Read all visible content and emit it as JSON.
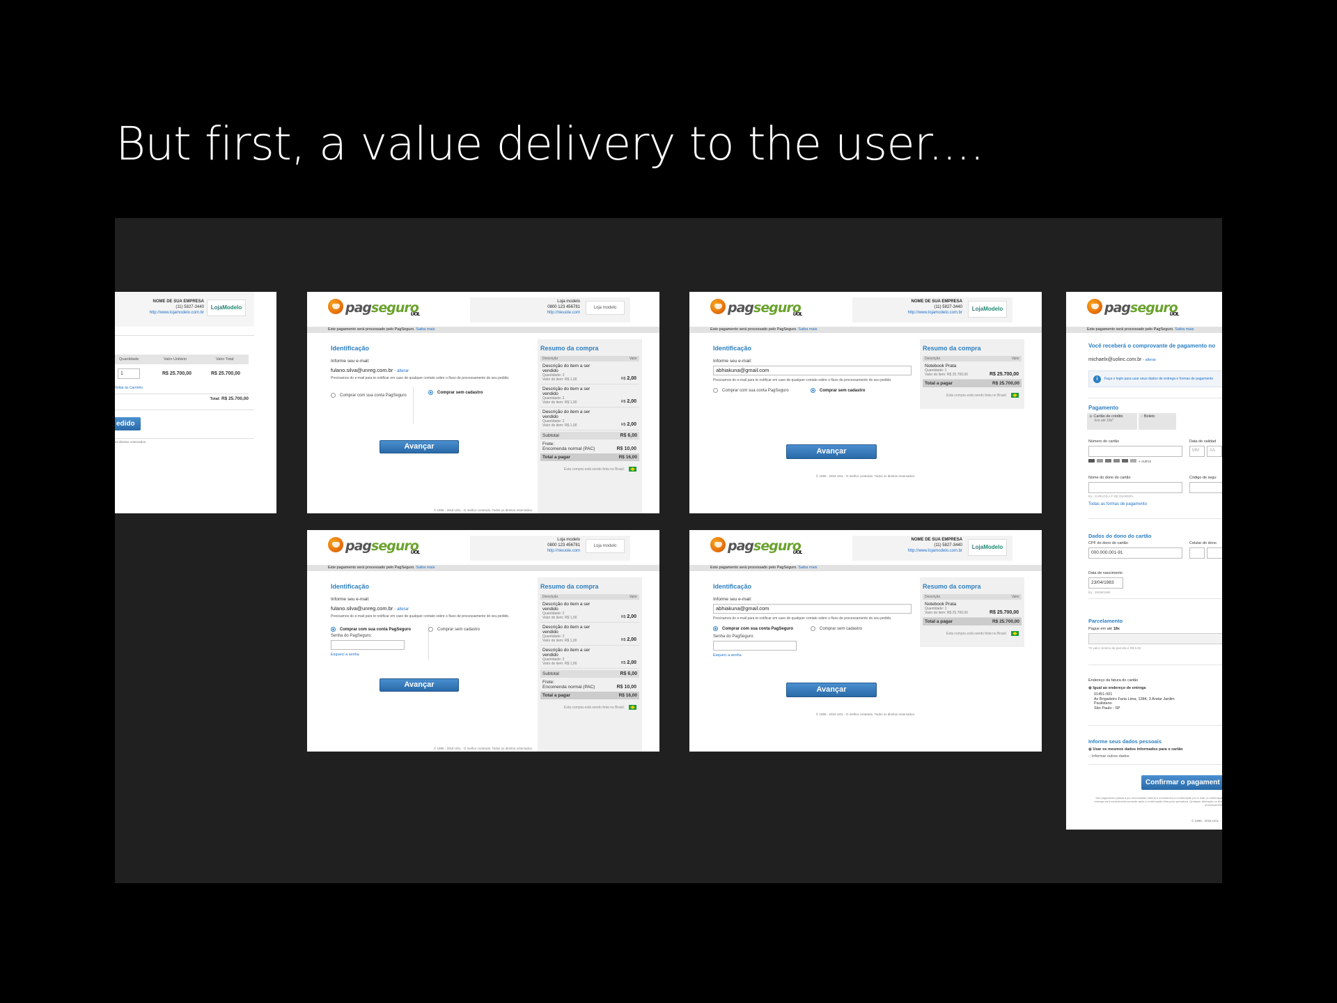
{
  "slide": {
    "title": "But first, a value delivery to the user...."
  },
  "common": {
    "logo_text_a": "pag",
    "logo_text_b": "seguro",
    "logo_uol": "UOL",
    "bar_text": "Este pagamento será processado pelo PagSeguro.",
    "bar_link": "Saiba mais",
    "ident_title": "Identificação",
    "email_label": "Informe seu e-mail:",
    "alterar": "- alterar",
    "note": "Precisamos do e-mail para te notificar em caso de qualquer contato sobre o fluxo de processamento do seu pedido.",
    "radio_account": "Comprar com sua conta PagSeguro",
    "radio_guest": "Comprar sem cadastro",
    "pwd_label": "Senha do PagSeguro:",
    "forgot": "Esqueci a senha",
    "button": "Avançar",
    "summary_title": "Resumo da compra",
    "col_desc": "Descrição",
    "col_val": "Valor",
    "subtotal_label": "Subtotal",
    "total_label": "Total a pagar",
    "brazil_note": "Esta compra está sendo feita no",
    "brazil_word": "Brasil.",
    "footer_a": "© 1996 - 2018 UOL - O melhor conteúdo. Todos os direitos reservados.",
    "footer_b": "© 1996 - 2018 UOL - O melhor conteúdo. Todos os direitos reservados."
  },
  "store_a": {
    "line1": "Loja modelo",
    "line2": "0800 123 456781",
    "link": "http://nieuole.com",
    "img_alt": "Loja modelo"
  },
  "store_b": {
    "line1": "NOME DE SUA EMPRESA",
    "line2": "(11) 5827-3440",
    "link": "http://www.lojamodelo.com.br",
    "brand_a": "Loja",
    "brand_b": "Modelo"
  },
  "emails": {
    "a": "fulano.silva@unreg.com.br",
    "b": "abhiakuna@gmail.com",
    "c": "michaelx@uolinc.com.br"
  },
  "items": [
    {
      "desc": "Descrição do item a ser vendido",
      "qty": "Quantidade: 2",
      "unit": "Valor do item: R$ 1,00",
      "rs": "R$",
      "val": "2,00"
    },
    {
      "desc": "Descrição do item a ser vendido",
      "qty": "Quantidade: 2",
      "unit": "Valor do item: R$ 1,00",
      "rs": "R$",
      "val": "2,00"
    },
    {
      "desc": "Descrição do item a ser vendido",
      "qty": "Quantidade: 2",
      "unit": "Valor do item: R$ 1,00",
      "rs": "R$",
      "val": "2,00"
    }
  ],
  "subtotal": "R$ 6,00",
  "frete": {
    "label": "Frete:",
    "desc": "Encomenda normal (PAC)",
    "val": "R$ 10,00"
  },
  "total_a": "R$ 16,00",
  "notebook": {
    "desc": "Notebook Prata",
    "qty": "Quantidade: 1",
    "unit": "Valor do item: R$ 25.700,00",
    "val": "R$ 25.700,00"
  },
  "total_b": "R$ 25.700,00",
  "cart": {
    "col_qty": "Quantidade",
    "col_unit": "Valor Unitário",
    "col_total": "Valor Total",
    "qty": "1",
    "unit": "R$ 25.700,00",
    "total": "R$ 25.700,00",
    "back": "Voltar às Carrinho",
    "total_label": "Total:",
    "total_val": "R$ 25.700,00",
    "btn": "edido",
    "footer": "os direitos reservados."
  },
  "partial": {
    "receipt": "Você receberá o comprovante de pagamento no",
    "login_note": "Faça o login para usar seus dados de entrega e formas de pagamento",
    "pay_title": "Pagamento",
    "card": "Cartão de crédito",
    "card_sub": "Em até 18x*",
    "boleto": "Boleto",
    "card_num": "Número do cartão",
    "validity": "Data de validad",
    "mm": "MM",
    "aa": "AA",
    "more": "+ outros",
    "owner_name": "Nome do dono do cartão",
    "cvv": "Código de segu",
    "owner_hint": "Ex.: CARLOS A F DE OLIVEIRA",
    "all_methods": "Todas as formas de pagamento",
    "owner_title": "Dados do dono do cartão",
    "cpf_label": "CPF do dono do cartão",
    "cpf": "000.000.001-91",
    "cel": "Celular do dono",
    "birth_label": "Data de nascimento",
    "birth": "23/04/1983",
    "birth_hint": "Ex.: 20/05/1980",
    "parc_title": "Parcelamento",
    "parc_label": "Pague em até",
    "parc_val": "18x",
    "parc_note": "*O valor mínimo da parcela é R$ 5,00",
    "addr_label": "Endereço da fatura do cartão",
    "addr_same": "Igual ao endereço de entrega",
    "addr_lines": [
      "01451-001",
      "Av Brigadeiro Faria Lima, 1384, 3 Andar Jardim",
      "Paulistano",
      "São Paulo - SP"
    ],
    "personal_title": "Informe seus dados pessoais",
    "personal_same": "Usar os mesmos dados informados para o cartão",
    "personal_other": "Informar outros dados",
    "confirm": "Confirmar o pagament",
    "fine": "Seu pagamento passará por uma análise interna e enviaremos a confirmação por e-mail. A confirmação da entrega será considerada somente após a confirmação feita pela operadora. Qualquer alteração no fluxo de processamento do",
    "footer": "© 1996 - 2018 UOL -"
  }
}
